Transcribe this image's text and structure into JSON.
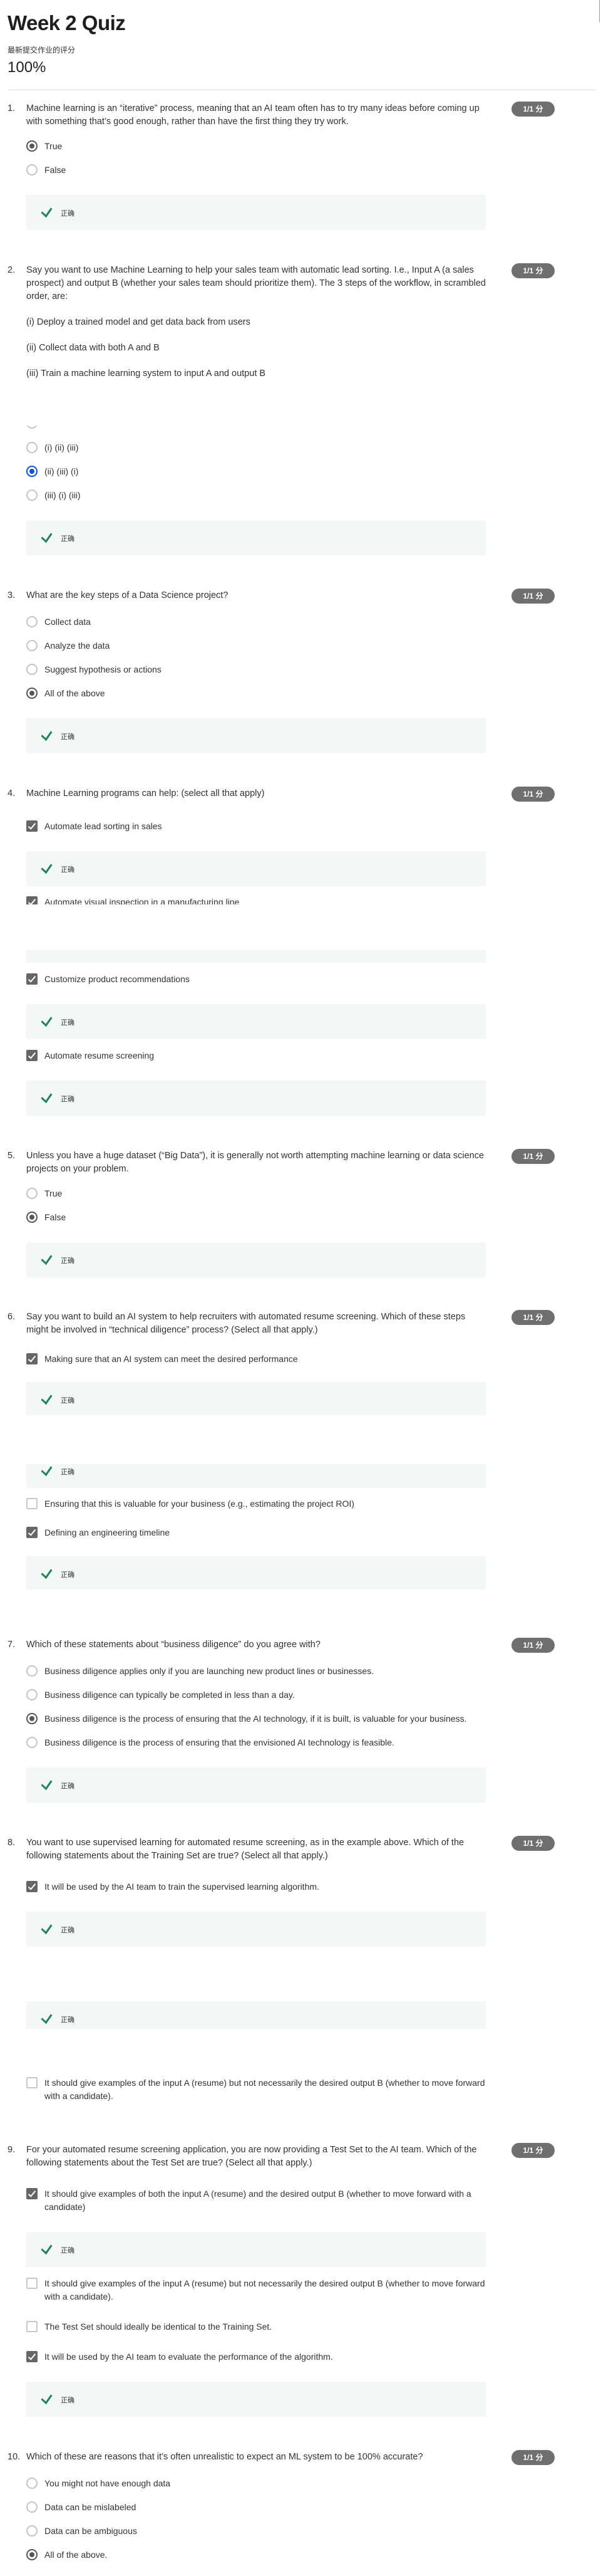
{
  "page": {
    "title": "Week 2 Quiz",
    "grade_label": "最新提交作业的评分",
    "grade": "100%"
  },
  "colors": {
    "selected_blue": "#0056d2",
    "badge": "#6f6f6f",
    "feedback_bg": "#f3f8f6",
    "check_green": "#1f8354"
  },
  "questions": [
    {
      "number": "1.",
      "text": "Machine learning is an “iterative” process, meaning that an AI team often has to try many ideas before coming up with something that’s good enough, rather than have the first thing they try work.",
      "score": "1/1 分",
      "options": [
        {
          "label": "True",
          "type": "radio",
          "selected": true
        },
        {
          "label": "False",
          "type": "radio",
          "selected": false
        }
      ],
      "feedback": [
        {
          "label": "正确",
          "icon": "checkmark-icon"
        }
      ]
    },
    {
      "number": "2.",
      "text": "Say you want to use Machine Learning to help your sales team with automatic lead sorting. I.e., Input A (a sales prospect) and output B (whether your sales team should prioritize them). The 3 steps of the workflow, in scrambled order, are:",
      "score": "1/1 分",
      "steps": [
        "(i) Deploy a trained model and get data back from users",
        "(ii) Collect data with both A and B",
        "(iii) Train a machine learning system to input A and output B"
      ],
      "options": [
        {
          "label": "(i) (ii) (iii)",
          "type": "radio",
          "selected": false
        },
        {
          "label": "(ii) (iii) (i)",
          "type": "radio",
          "selected": true
        },
        {
          "label": "(iii) (i) (iii)",
          "type": "radio",
          "selected": false
        }
      ],
      "feedback": [
        {
          "label": "正确",
          "icon": "checkmark-icon"
        }
      ]
    },
    {
      "number": "3.",
      "text": "What are the key steps of a Data Science project?",
      "score": "1/1 分",
      "options": [
        {
          "label": "Collect data",
          "type": "radio",
          "selected": false
        },
        {
          "label": "Analyze the data",
          "type": "radio",
          "selected": false
        },
        {
          "label": "Suggest hypothesis or actions",
          "type": "radio",
          "selected": false
        },
        {
          "label": "All of the above",
          "type": "radio",
          "selected": true
        }
      ],
      "feedback": [
        {
          "label": "正确",
          "icon": "checkmark-icon"
        }
      ]
    },
    {
      "number": "4.",
      "text": "Machine Learning programs can help: (select all that apply)",
      "score": "1/1 分",
      "options": [
        {
          "label": "Automate lead sorting in sales",
          "type": "checkbox",
          "selected": true
        },
        {
          "label": "Automate visual inspection in a manufacturing line",
          "type": "checkbox",
          "selected": true
        },
        {
          "label": "Customize product recommendations",
          "type": "checkbox",
          "selected": true
        },
        {
          "label": "Automate resume screening",
          "type": "checkbox",
          "selected": true
        }
      ],
      "feedback": [
        {
          "label": "正确",
          "icon": "checkmark-icon"
        },
        {
          "label": "",
          "icon": ""
        },
        {
          "label": "正确",
          "icon": "checkmark-icon"
        },
        {
          "label": "正确",
          "icon": "checkmark-icon"
        }
      ]
    },
    {
      "number": "5.",
      "text": "Unless you have a huge dataset (“Big Data”), it is generally not worth attempting machine learning or data science projects on your problem.",
      "score": "1/1 分",
      "options": [
        {
          "label": "True",
          "type": "radio",
          "selected": false
        },
        {
          "label": "False",
          "type": "radio",
          "selected": true
        }
      ],
      "feedback": [
        {
          "label": "正确",
          "icon": "checkmark-icon"
        }
      ]
    },
    {
      "number": "6.",
      "text": "Say you want to build an AI system to help recruiters with automated resume screening. Which of these steps might be involved in “technical diligence” process?  (Select all that apply.)",
      "score": "1/1 分",
      "options": [
        {
          "label": "Making sure that an AI system can meet the desired performance",
          "type": "checkbox",
          "selected": true
        },
        {
          "label": "Ensuring that this is valuable for your business (e.g., estimating the project ROI)",
          "type": "checkbox",
          "selected": false
        },
        {
          "label": "Defining an engineering timeline",
          "type": "checkbox",
          "selected": true
        }
      ],
      "feedback": [
        {
          "label": "正确",
          "icon": "checkmark-icon"
        },
        {
          "label": "正确",
          "icon": "checkmark-icon"
        },
        {
          "label": "正确",
          "icon": "checkmark-icon"
        }
      ]
    },
    {
      "number": "7.",
      "text": "Which of these statements about “business diligence” do you agree with?",
      "score": "1/1 分",
      "options": [
        {
          "label": "Business diligence applies only if you are launching new product lines or businesses.",
          "type": "radio",
          "selected": false
        },
        {
          "label": "Business diligence can typically be completed in less than a day.",
          "type": "radio",
          "selected": false
        },
        {
          "label": "Business diligence is the process of ensuring that the AI technology, if it is built, is valuable for your business.",
          "type": "radio",
          "selected": true
        },
        {
          "label": "Business diligence is the process of ensuring that the envisioned AI technology is feasible.",
          "type": "radio",
          "selected": false
        }
      ],
      "feedback": [
        {
          "label": "正确",
          "icon": "checkmark-icon"
        }
      ]
    },
    {
      "number": "8.",
      "text": "You want to use supervised learning for automated resume screening, as in the example above. Which of the following statements about the Training Set are true? (Select all that apply.)",
      "score": "1/1 分",
      "options": [
        {
          "label": "It will be used by the AI team to train the supervised learning algorithm.",
          "type": "checkbox",
          "selected": true
        },
        {
          "label": "It should give examples of the input A (resume) but not necessarily the desired output B (whether to move forward with a candidate).",
          "type": "checkbox",
          "selected": false
        }
      ],
      "feedback": [
        {
          "label": "正确",
          "icon": "checkmark-icon"
        },
        {
          "label": "正确",
          "icon": "checkmark-icon"
        }
      ]
    },
    {
      "number": "9.",
      "text": "For your automated resume screening application, you are now providing a Test Set to the AI team. Which of the following statements about the Test Set are true? (Select all that apply.)",
      "score": "1/1 分",
      "options": [
        {
          "label": "It should give examples of both the input A (resume) and the desired output B (whether to move forward with a candidate)",
          "type": "checkbox",
          "selected": true
        },
        {
          "label": "It should give examples of the input A (resume) but not necessarily the desired output B (whether to move forward with a candidate).",
          "type": "checkbox",
          "selected": false
        },
        {
          "label": "The Test Set should ideally be identical to the Training Set.",
          "type": "checkbox",
          "selected": false
        },
        {
          "label": "It will be used by the AI team to evaluate the performance of the algorithm.",
          "type": "checkbox",
          "selected": true
        }
      ],
      "feedback": [
        {
          "label": "正确",
          "icon": "checkmark-icon"
        },
        {
          "label": "正确",
          "icon": "checkmark-icon"
        }
      ]
    },
    {
      "number": "10.",
      "text": "Which of these are reasons that it’s often unrealistic to expect an ML system to be 100% accurate?",
      "score": "1/1 分",
      "options": [
        {
          "label": "You might not have enough data",
          "type": "radio",
          "selected": false
        },
        {
          "label": "Data can be mislabeled",
          "type": "radio",
          "selected": false
        },
        {
          "label": "Data can be ambiguous",
          "type": "radio",
          "selected": false
        },
        {
          "label": "All of the above.",
          "type": "radio",
          "selected": true
        }
      ],
      "feedback": []
    }
  ]
}
